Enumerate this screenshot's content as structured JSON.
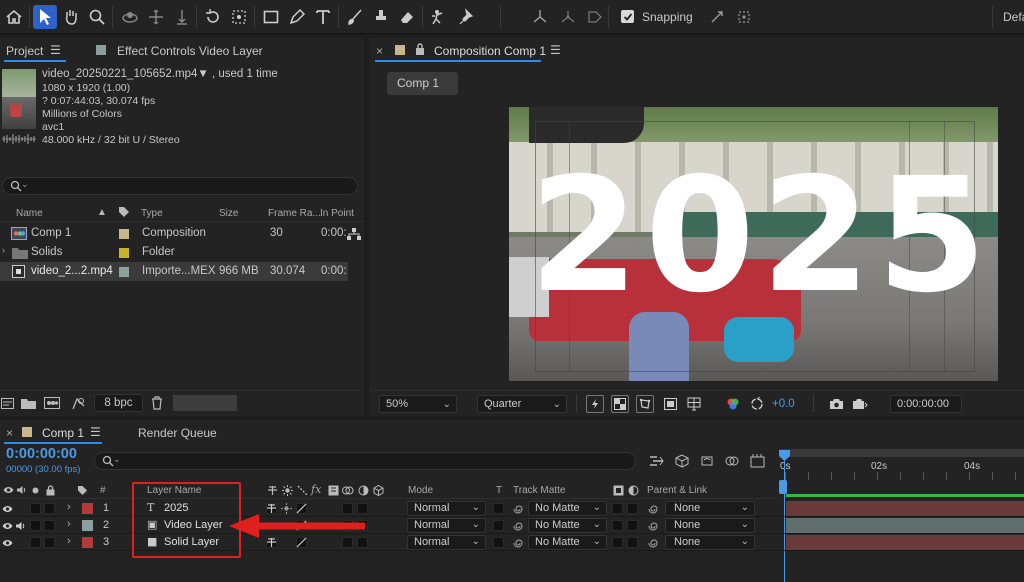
{
  "toolbar": {
    "snapping_label": "Snapping",
    "workspace_label": "Default",
    "snapping_checked": true
  },
  "project_panel": {
    "tab_project": "Project",
    "tab_effects": "Effect Controls Video Layer",
    "info": {
      "filename": "video_20250221_105652.mp4▼ , used 1 time",
      "dimensions": "1080 x 1920 (1.00)",
      "duration": "? 0:07:44:03, 30.074 fps",
      "colors": "Millions of Colors",
      "codec": "avc1",
      "audio": "48.000 kHz / 32 bit U / Stereo"
    },
    "search_placeholder": "",
    "columns": {
      "name": "Name",
      "type": "Type",
      "size": "Size",
      "frame_rate": "Frame Ra...",
      "in_point": "In Point"
    },
    "items": [
      {
        "name": "Comp 1",
        "type": "Composition",
        "size": "",
        "frame_rate": "30",
        "in_point": "0:00:",
        "color": "#c8b68c"
      },
      {
        "name": "Solids",
        "type": "Folder",
        "size": "",
        "frame_rate": "",
        "in_point": "",
        "color": "#c8b428"
      },
      {
        "name": "video_2...2.mp4",
        "type": "Importe...MEX",
        "size": "966 MB",
        "frame_rate": "30.074",
        "in_point": "0:00:",
        "color": "#8ca09c"
      }
    ],
    "bpc_label": "8 bpc"
  },
  "comp_panel": {
    "tab_title": "Composition Comp 1",
    "comp_button": "Comp 1",
    "viewer_text": "2025",
    "zoom": "50%",
    "resolution": "Quarter",
    "exposure": "+0.0",
    "timecode": "0:00:00:00"
  },
  "timeline": {
    "tab_comp": "Comp 1",
    "tab_render": "Render Queue",
    "timecode": "0:00:00:00",
    "fps_label": "00000 (30.00 fps)",
    "columns": {
      "num": "#",
      "layer_name": "Layer Name",
      "mode": "Mode",
      "t": "T",
      "track_matte": "Track Matte",
      "parent": "Parent & Link"
    },
    "ruler": [
      "0s",
      "02s",
      "04s"
    ],
    "layers": [
      {
        "num": "1",
        "name": "2025",
        "icon": "T",
        "color": "#b33a3a",
        "mode": "Normal",
        "matte": "No Matte",
        "parent": "None"
      },
      {
        "num": "2",
        "name": "Video Layer",
        "icon": "▣",
        "color": "#8aa0a0",
        "mode": "Normal",
        "matte": "No Matte",
        "parent": "None"
      },
      {
        "num": "3",
        "name": "Solid Layer",
        "icon": "■",
        "color": "#b33a3a",
        "mode": "Normal",
        "matte": "No Matte",
        "parent": "None"
      }
    ]
  }
}
